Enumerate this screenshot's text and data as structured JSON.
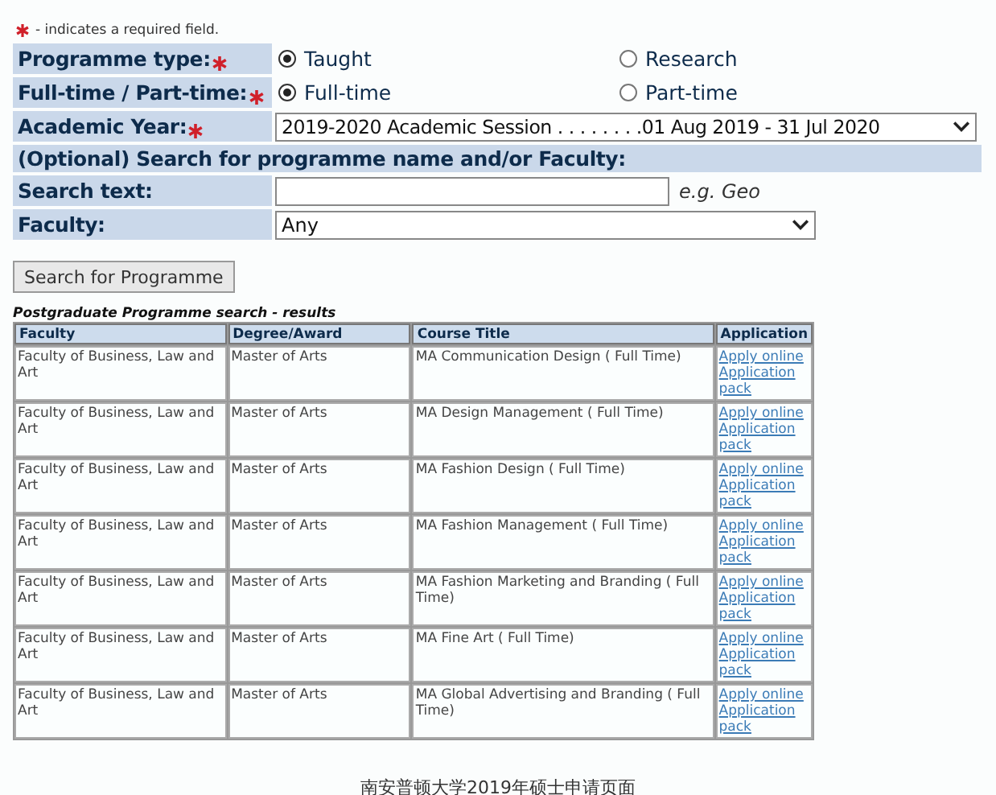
{
  "required_note": "- indicates a required field.",
  "form": [
    {
      "kind": "radio",
      "label": "Programme type:",
      "required": true,
      "options": [
        {
          "label": "Taught",
          "selected": true
        },
        {
          "label": "Research",
          "selected": false
        }
      ]
    },
    {
      "kind": "radio",
      "label": "Full-time / Part-time:",
      "required": true,
      "options": [
        {
          "label": "Full-time",
          "selected": true
        },
        {
          "label": "Part-time",
          "selected": false
        }
      ]
    },
    {
      "kind": "select",
      "label": "Academic Year:",
      "required": true,
      "value": "2019-2020 Academic Session . . . . . . . .01 Aug 2019 - 31 Jul 2020",
      "wide": true
    },
    {
      "kind": "heading",
      "label": "(Optional) Search for programme name and/or Faculty:"
    },
    {
      "kind": "text",
      "label": "Search text:",
      "required": false,
      "hint": "e.g. Geo"
    },
    {
      "kind": "select",
      "label": "Faculty:",
      "required": false,
      "value": "Any",
      "wide": false
    }
  ],
  "search_button": "Search for Programme",
  "results": {
    "title": "Postgraduate Programme search - results",
    "columns": [
      "Faculty",
      "Degree/Award",
      "Course Title",
      "Application"
    ],
    "rows": [
      {
        "faculty": "Faculty of Business, Law and Art",
        "degree": "Master of Arts",
        "course": "MA Communication Design ( Full Time)",
        "links": [
          "Apply online",
          "Application pack"
        ]
      },
      {
        "faculty": "Faculty of Business, Law and Art",
        "degree": "Master of Arts",
        "course": "MA Design Management ( Full Time)",
        "links": [
          "Apply online",
          "Application pack"
        ]
      },
      {
        "faculty": "Faculty of Business, Law and Art",
        "degree": "Master of Arts",
        "course": "MA Fashion Design ( Full Time)",
        "links": [
          "Apply online",
          "Application pack"
        ]
      },
      {
        "faculty": "Faculty of Business, Law and Art",
        "degree": "Master of Arts",
        "course": "MA Fashion Management ( Full Time)",
        "links": [
          "Apply online",
          "Application pack"
        ]
      },
      {
        "faculty": "Faculty of Business, Law and Art",
        "degree": "Master of Arts",
        "course": "MA Fashion Marketing and Branding ( Full Time)",
        "links": [
          "Apply online",
          "Application pack"
        ]
      },
      {
        "faculty": "Faculty of Business, Law and Art",
        "degree": "Master of Arts",
        "course": "MA Fine Art ( Full Time)",
        "links": [
          "Apply online",
          "Application pack"
        ]
      },
      {
        "faculty": "Faculty of Business, Law and Art",
        "degree": "Master of Arts",
        "course": "MA Global Advertising and Branding ( Full Time)",
        "links": [
          "Apply online",
          "Application pack"
        ]
      }
    ]
  },
  "caption": "南安普顿大学2019年硕士申请页面"
}
